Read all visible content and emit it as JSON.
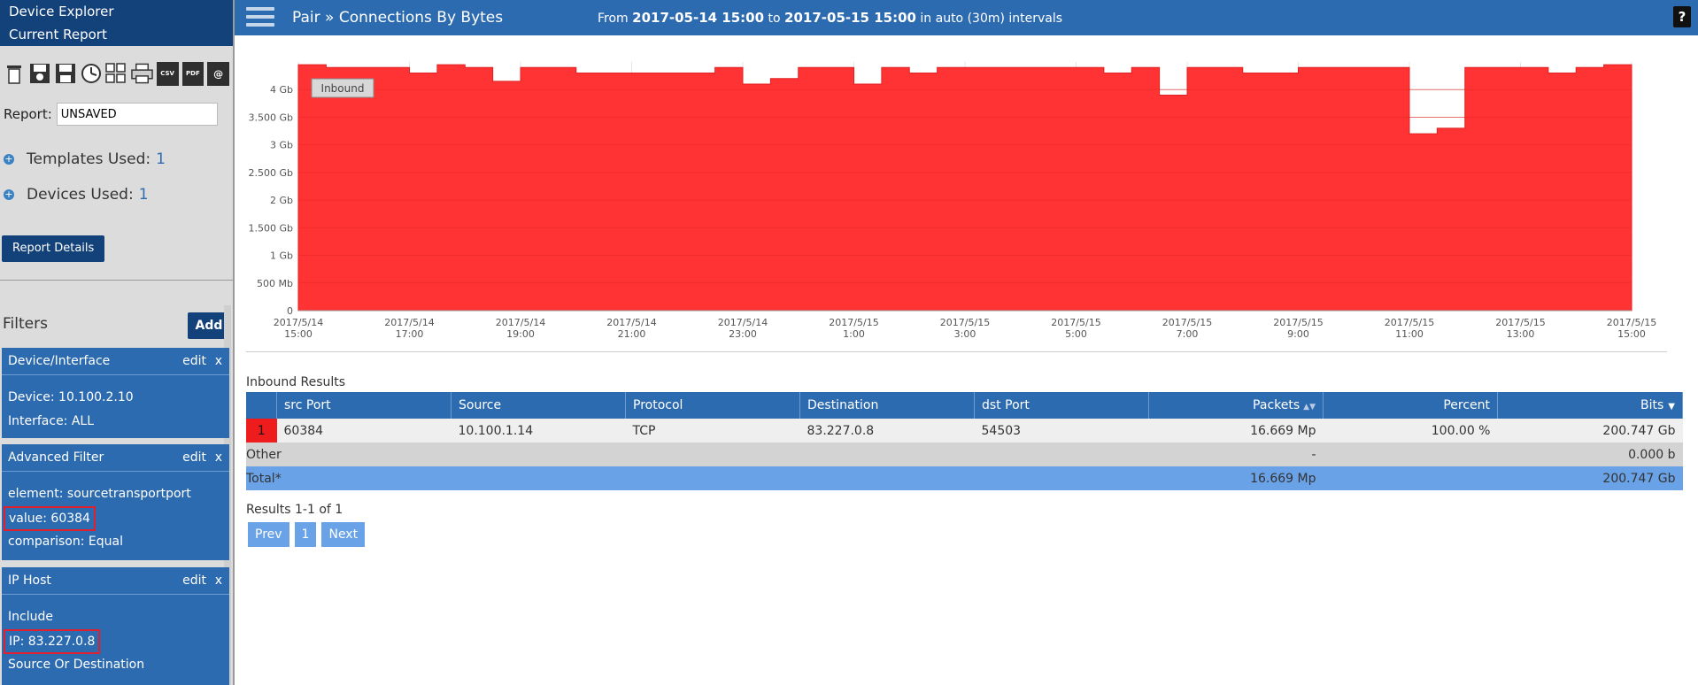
{
  "sidebar": {
    "device_explorer": "Device Explorer",
    "current_report": "Current Report",
    "toolbar": [
      "trash-icon",
      "floppy-open-icon",
      "floppy-save-icon",
      "clock-icon",
      "grid-icon",
      "printer-icon",
      "csv-icon",
      "pdf-icon",
      "email-icon"
    ],
    "csv_label": "CSV",
    "pdf_label": "PDF",
    "email_label": "@",
    "report_label": "Report:",
    "report_value": "UNSAVED",
    "templates_label": "Templates Used:",
    "templates_count": "1",
    "devices_label": "Devices Used:",
    "devices_count": "1",
    "report_details": "Report Details",
    "filters_title": "Filters",
    "add_label": "Add",
    "filters": [
      {
        "title": "Device/Interface",
        "edit": "edit",
        "close": "x",
        "lines": [
          "Device: 10.100.2.10",
          "Interface: ALL"
        ]
      },
      {
        "title": "Advanced Filter",
        "edit": "edit",
        "close": "x",
        "lines": [
          "element: sourcetransportport",
          "value: 60384",
          "comparison: Equal"
        ]
      },
      {
        "title": "IP Host",
        "edit": "edit",
        "close": "x",
        "lines": [
          "Include",
          "IP: 83.227.0.8",
          "Source Or Destination"
        ]
      }
    ]
  },
  "header": {
    "breadcrumb": "Pair » Connections By Bytes",
    "range_from": "From",
    "range_start": "2017-05-14 15:00",
    "range_to": "to",
    "range_end": "2017-05-15 15:00",
    "range_suffix": "in auto (30m) intervals",
    "help": "?"
  },
  "chart_data": {
    "type": "area",
    "series": [
      {
        "name": "Inbound",
        "color": "#ff3333",
        "values": [
          4.45,
          4.4,
          4.4,
          4.4,
          4.3,
          4.45,
          4.4,
          4.15,
          4.4,
          4.4,
          4.3,
          4.3,
          4.3,
          4.3,
          4.3,
          4.4,
          4.1,
          4.2,
          4.4,
          4.4,
          4.1,
          4.4,
          4.3,
          4.4,
          4.4,
          4.4,
          4.4,
          4.4,
          4.4,
          4.3,
          4.4,
          3.9,
          4.4,
          4.4,
          4.3,
          4.3,
          4.4,
          4.4,
          4.4,
          4.4,
          3.2,
          3.3,
          4.4,
          4.4,
          4.4,
          4.3,
          4.4,
          4.45
        ]
      }
    ],
    "yticks": [
      "0",
      "500 Mb",
      "1 Gb",
      "1.500 Gb",
      "2 Gb",
      "2.500 Gb",
      "3 Gb",
      "3.500 Gb",
      "4 Gb"
    ],
    "ytick_values": [
      0,
      0.5,
      1,
      1.5,
      2,
      2.5,
      3,
      3.5,
      4
    ],
    "ylim": [
      0,
      4.5
    ],
    "xticks": [
      {
        "date": "2017/5/14",
        "time": "15:00"
      },
      {
        "date": "2017/5/14",
        "time": "17:00"
      },
      {
        "date": "2017/5/14",
        "time": "19:00"
      },
      {
        "date": "2017/5/14",
        "time": "21:00"
      },
      {
        "date": "2017/5/14",
        "time": "23:00"
      },
      {
        "date": "2017/5/15",
        "time": "1:00"
      },
      {
        "date": "2017/5/15",
        "time": "3:00"
      },
      {
        "date": "2017/5/15",
        "time": "5:00"
      },
      {
        "date": "2017/5/15",
        "time": "7:00"
      },
      {
        "date": "2017/5/15",
        "time": "9:00"
      },
      {
        "date": "2017/5/15",
        "time": "11:00"
      },
      {
        "date": "2017/5/15",
        "time": "13:00"
      },
      {
        "date": "2017/5/15",
        "time": "15:00"
      }
    ],
    "legend": "Inbound",
    "legend_position": "top-left",
    "grid": true
  },
  "results": {
    "title": "Inbound Results",
    "columns": [
      "src Port",
      "Source",
      "Protocol",
      "Destination",
      "dst Port",
      "Packets",
      "Percent",
      "Bits"
    ],
    "row": {
      "rank": "1",
      "src_port": "60384",
      "source": "10.100.1.14",
      "protocol": "TCP",
      "destination": "83.227.0.8",
      "dst_port": "54503",
      "packets": "16.669 Mp",
      "percent": "100.00 %",
      "bits": "200.747 Gb"
    },
    "other": {
      "label": "Other",
      "packets": "-",
      "bits": "0.000 b"
    },
    "total": {
      "label": "Total*",
      "packets": "16.669 Mp",
      "bits": "200.747 Gb"
    },
    "count": "Results 1-1 of 1",
    "pager": {
      "prev": "Prev",
      "page": "1",
      "next": "Next"
    }
  },
  "colors": {
    "header_blue": "#2d6bb0",
    "navy": "#13417a",
    "area_red": "#ff3333",
    "highlight_red": "#e0202e"
  }
}
